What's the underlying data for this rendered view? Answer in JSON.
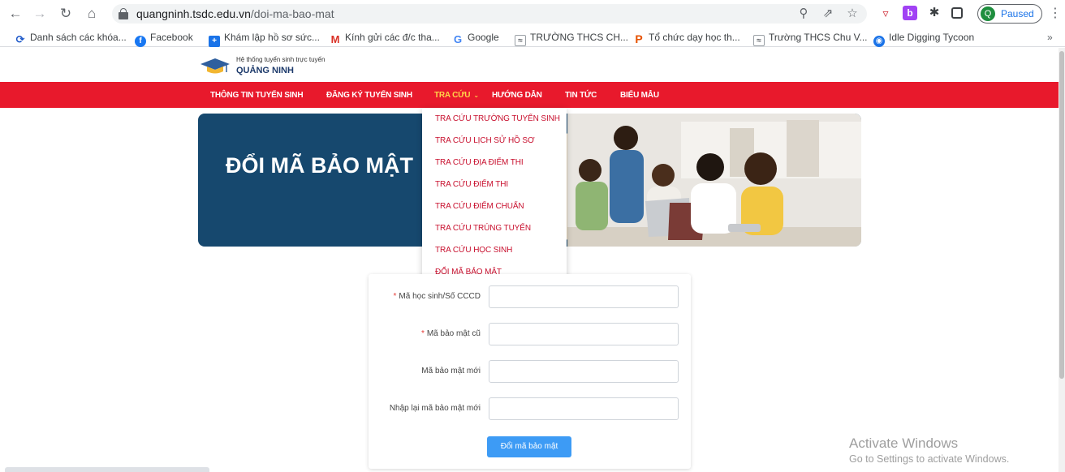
{
  "browser": {
    "url_domain": "quangninh.tsdc.edu.vn",
    "url_path": "/doi-ma-bao-mat",
    "profile_label": "Paused",
    "profile_initial": "Q"
  },
  "bookmarks": [
    {
      "label": "Danh sách các khóa...",
      "icon": "course-icon"
    },
    {
      "label": "Facebook",
      "icon": "facebook-icon"
    },
    {
      "label": "Khám lập hồ sơ sức...",
      "icon": "plus-square-icon"
    },
    {
      "label": "Kính gửi các đ/c tha...",
      "icon": "gmail-icon"
    },
    {
      "label": "Google",
      "icon": "google-icon"
    },
    {
      "label": "TRƯỜNG THCS CH...",
      "icon": "school-icon"
    },
    {
      "label": "Tổ chức dạy học th...",
      "icon": "p-logo-icon"
    },
    {
      "label": "Trường THCS Chu V...",
      "icon": "school-icon"
    },
    {
      "label": "Idle Digging Tycoon",
      "icon": "game-icon"
    }
  ],
  "site": {
    "brand_sub": "Hệ thống tuyển sinh trực tuyến",
    "brand_name": "QUẢNG NINH",
    "nav": [
      {
        "label": "THÔNG TIN TUYỂN SINH"
      },
      {
        "label": "ĐĂNG KÝ TUYỂN SINH"
      },
      {
        "label": "TRA CỨU"
      },
      {
        "label": "HƯỚNG DẪN"
      },
      {
        "label": "TIN TỨC"
      },
      {
        "label": "BIỂU MẪU"
      }
    ],
    "dropdown": [
      "TRA CỨU TRƯỜNG TUYỂN SINH",
      "TRA CỨU LỊCH SỬ HỒ SƠ",
      "TRA CỨU ĐỊA ĐIỂM THI",
      "TRA CỨU ĐIỂM THI",
      "TRA CỨU ĐIỂM CHUẨN",
      "TRA CỨU TRÚNG TUYỂN",
      "TRA CỨU HỌC SINH",
      "ĐỔI MÃ BẢO MẬT"
    ],
    "hero_title": "ĐỔI MÃ BẢO MẬT"
  },
  "form": {
    "fields": [
      {
        "label": "Mã học sinh/Số CCCD",
        "required": "*",
        "value": ""
      },
      {
        "label": "Mã bảo mật cũ",
        "required": "*",
        "value": ""
      },
      {
        "label": "Mã bảo mật mới",
        "required": "",
        "value": ""
      },
      {
        "label": "Nhập lại mã bảo mật mới",
        "required": "",
        "value": ""
      }
    ],
    "submit_label": "Đổi mã bảo mật"
  },
  "os_watermark": {
    "line1": "Activate Windows",
    "line2": "Go to Settings to activate Windows."
  },
  "colors": {
    "nav_red": "#e8192c",
    "dropdown_text": "#c8102e",
    "hero_blue": "#16486e",
    "button_blue": "#3d9bf5"
  }
}
